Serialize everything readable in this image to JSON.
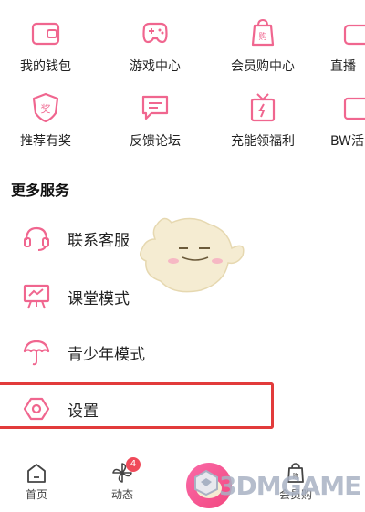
{
  "grid": {
    "row1": [
      {
        "label": "我的钱包",
        "icon": "wallet-icon"
      },
      {
        "label": "游戏中心",
        "icon": "gamepad-icon"
      },
      {
        "label": "会员购中心",
        "icon": "shopping-bag-icon"
      },
      {
        "label": "直播",
        "icon": "live-icon"
      }
    ],
    "row2": [
      {
        "label": "推荐有奖",
        "icon": "reward-shield-icon"
      },
      {
        "label": "反馈论坛",
        "icon": "feedback-icon"
      },
      {
        "label": "充能领福利",
        "icon": "gift-icon"
      },
      {
        "label": "BW活",
        "icon": "bw-icon"
      }
    ]
  },
  "more_services": {
    "title": "更多服务",
    "items": [
      {
        "label": "联系客服",
        "icon": "headset-icon"
      },
      {
        "label": "课堂模式",
        "icon": "classroom-icon"
      },
      {
        "label": "青少年模式",
        "icon": "umbrella-icon"
      },
      {
        "label": "设置",
        "icon": "settings-icon"
      }
    ]
  },
  "tabbar": {
    "tabs": [
      {
        "label": "首页",
        "icon": "home-icon"
      },
      {
        "label": "动态",
        "icon": "pinwheel-icon",
        "badge": "4"
      },
      {
        "label": "",
        "icon": "mascot-icon"
      },
      {
        "label": "会员购",
        "icon": "shopping-bag-icon"
      }
    ]
  },
  "watermark": {
    "text": "3DMGAME"
  },
  "colors": {
    "accent": "#f0668f",
    "highlight": "#e23b3b",
    "badge": "#f04a5a"
  }
}
